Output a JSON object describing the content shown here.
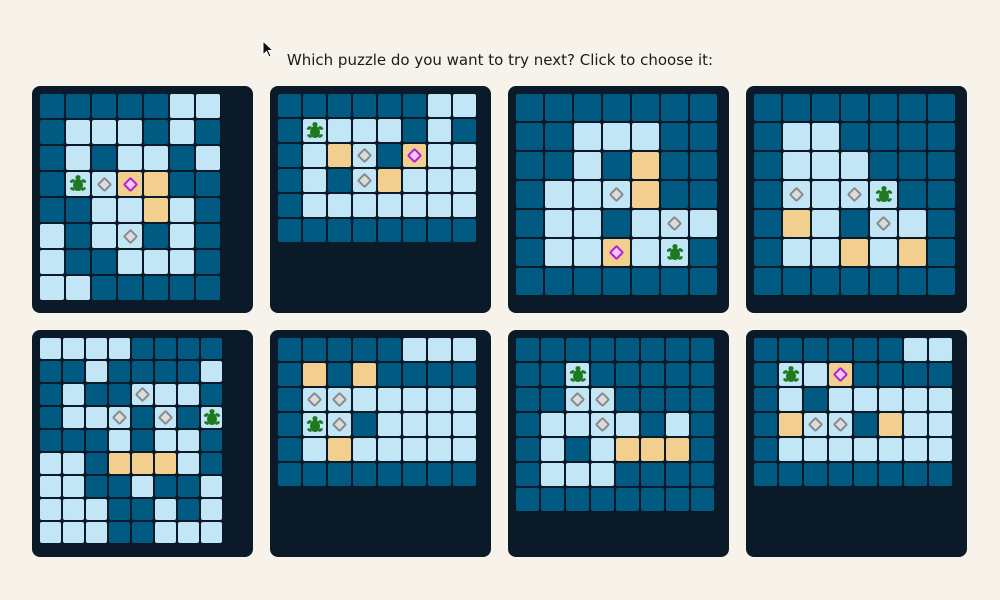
{
  "prompt": "Which puzzle do you want to try next? Click to choose it:",
  "legend": {
    "#": "water",
    ".": "floor",
    "T": "target",
    "c": "crate",
    "C": "crate-on-target",
    "p": "player"
  },
  "colors": {
    "background": "#f7f3ea",
    "panel": "#0b1a28",
    "water": "#005a82",
    "floor": "#c2e6f5",
    "target": "#f3cf8f",
    "crate_border": "#8a8a8a",
    "gem_on_target": "#b021d4",
    "turtle": "#1f7a1f"
  },
  "puzzles": [
    {
      "id": 1,
      "rows": [
        "#####..",
        "#...#.#",
        "#.#..#.",
        "#pcCT##",
        "##..T.#",
        ".#.c#.#",
        ".##...#",
        "..#####"
      ]
    },
    {
      "id": 2,
      "rows": [
        "######..",
        "#p...#.#",
        "#.Tc#C..",
        "#.#cT...",
        "#.......",
        "########"
      ]
    },
    {
      "id": 3,
      "rows": [
        "#######",
        "##...##",
        "##.#T##",
        "#..cT##",
        "#..#.c.",
        "#..C.p#",
        "#######"
      ]
    },
    {
      "id": 4,
      "rows": [
        "#######",
        "#..####",
        "#...###",
        "#c.cp##",
        "#T.#c.#",
        "#..T.T#",
        "#######"
      ]
    },
    {
      "id": 5,
      "rows": [
        "....####",
        "##.####.",
        "#.##c..#",
        "#..c#c#p",
        "###.#..#",
        "..#TTT.#",
        "..##.##.",
        "...##.#.",
        "...##..."
      ]
    },
    {
      "id": 6,
      "rows": [
        "#####...",
        "#T#T####",
        "#cc.....",
        "#pc#....",
        "#.T.....",
        "########"
      ]
    },
    {
      "id": 7,
      "rows": [
        "########",
        "##p#####",
        "##cc####",
        "#..c.#.#",
        "#.#.TTT#",
        "#...####",
        "########"
      ]
    },
    {
      "id": 8,
      "rows": [
        "######..",
        "#p.C####",
        "#.#.....",
        "#Tcc#T..",
        "#.......",
        "########"
      ]
    }
  ]
}
